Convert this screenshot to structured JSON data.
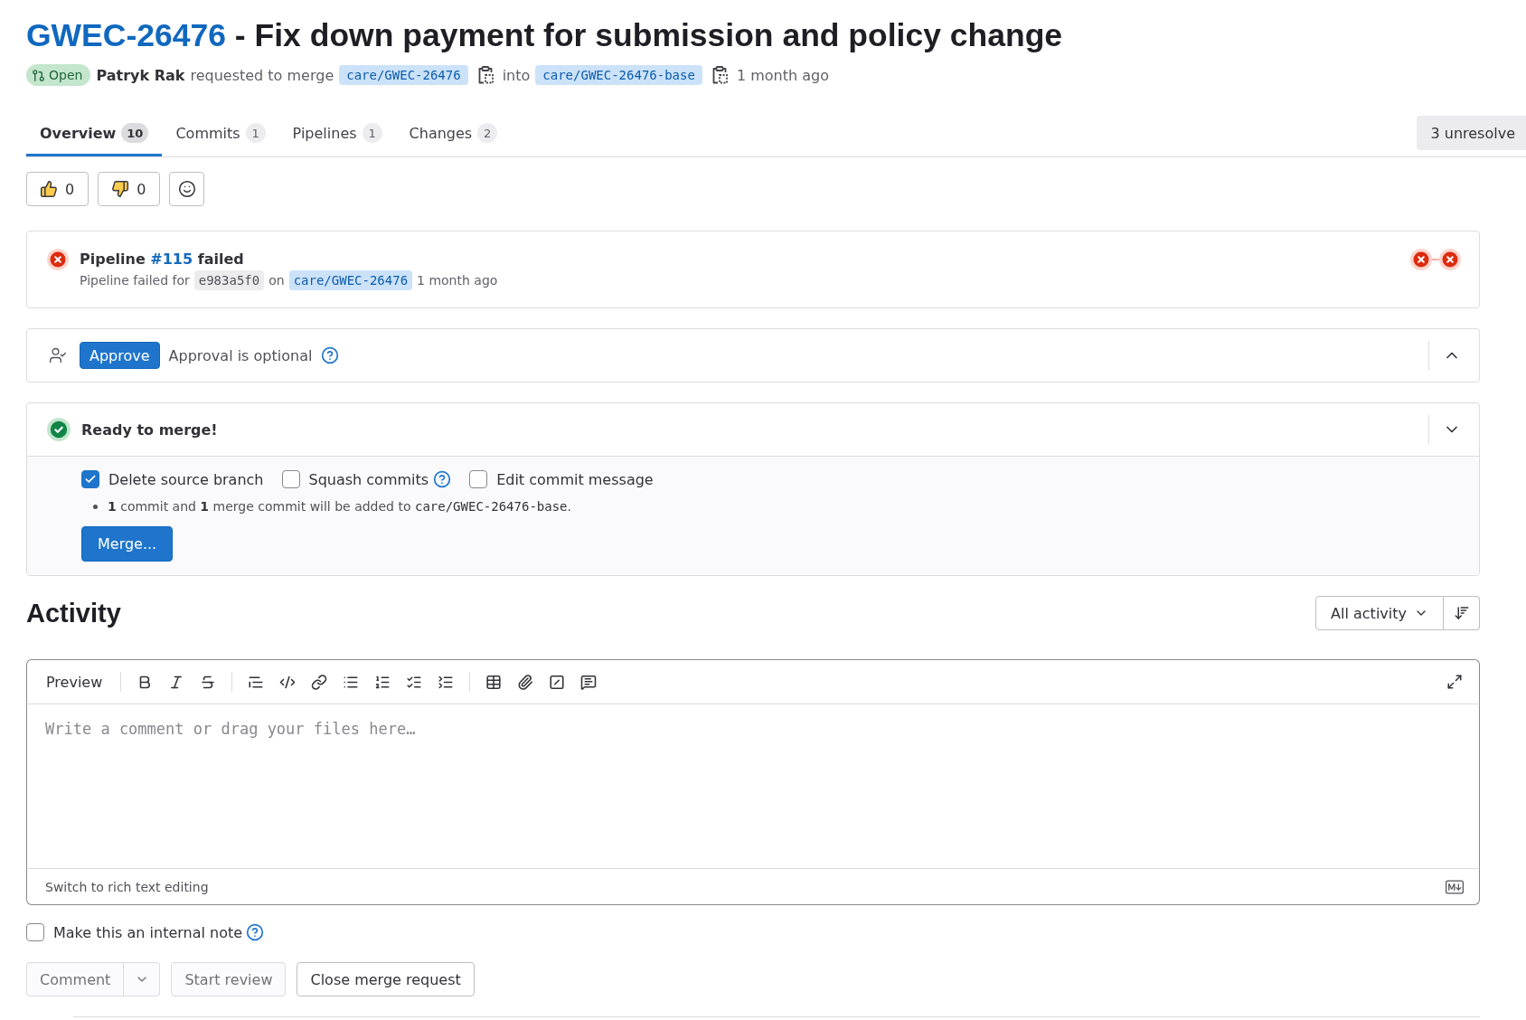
{
  "title": {
    "reference": "GWEC-26476",
    "text": "- Fix down payment for submission and policy change"
  },
  "meta": {
    "status": "Open",
    "author": "Patryk Rak",
    "action": "requested to merge",
    "source_branch": "care/GWEC-26476",
    "connector": "into",
    "target_branch": "care/GWEC-26476-base",
    "time": "1 month ago"
  },
  "tabs": [
    {
      "label": "Overview",
      "count": "10",
      "selected": true
    },
    {
      "label": "Commits",
      "count": "1",
      "selected": false
    },
    {
      "label": "Pipelines",
      "count": "1",
      "selected": false
    },
    {
      "label": "Changes",
      "count": "2",
      "selected": false
    }
  ],
  "unresolved_button": "3 unresolve",
  "reactions": [
    {
      "kind": "thumbs_up",
      "count": "0"
    },
    {
      "kind": "thumbs_down",
      "count": "0"
    }
  ],
  "pipeline": {
    "failed": true,
    "label": "Pipeline",
    "number": "#115",
    "result": "failed",
    "detail": "Pipeline failed for",
    "commit": "e983a5f0",
    "on": "on",
    "branch": "care/GWEC-26476",
    "time": "1 month ago",
    "stages": [
      {
        "failed": true
      },
      {
        "failed": true
      }
    ]
  },
  "approval": {
    "button": "Approve",
    "text": "Approval is optional",
    "expanded": true
  },
  "merge": {
    "title": "Ready to merge!",
    "expanded": false,
    "options": [
      {
        "label": "Delete source branch",
        "checked": true,
        "help": false
      },
      {
        "label": "Squash commits",
        "checked": false,
        "help": true
      },
      {
        "label": "Edit commit message",
        "checked": false,
        "help": false
      }
    ],
    "info": {
      "text": "**1** commit and **1** merge commit will be added to",
      "branch": "care/GWEC-26476-base",
      "end": "."
    },
    "button": "Merge..."
  },
  "activity": {
    "title": "Activity",
    "filter": "All activity"
  },
  "editor": {
    "mode_tab": "Preview",
    "placeholder": "Write a comment or drag your files here…",
    "footer_link": "Switch to rich text editing"
  },
  "internal_note": {
    "label": "Make this an internal note",
    "checked": false
  },
  "actions": [
    {
      "kind": "split",
      "label": "Comment",
      "disabled": true
    },
    {
      "kind": "plain",
      "label": "Start review",
      "disabled": true
    },
    {
      "kind": "plain",
      "label": "Close merge request",
      "disabled": false
    }
  ]
}
